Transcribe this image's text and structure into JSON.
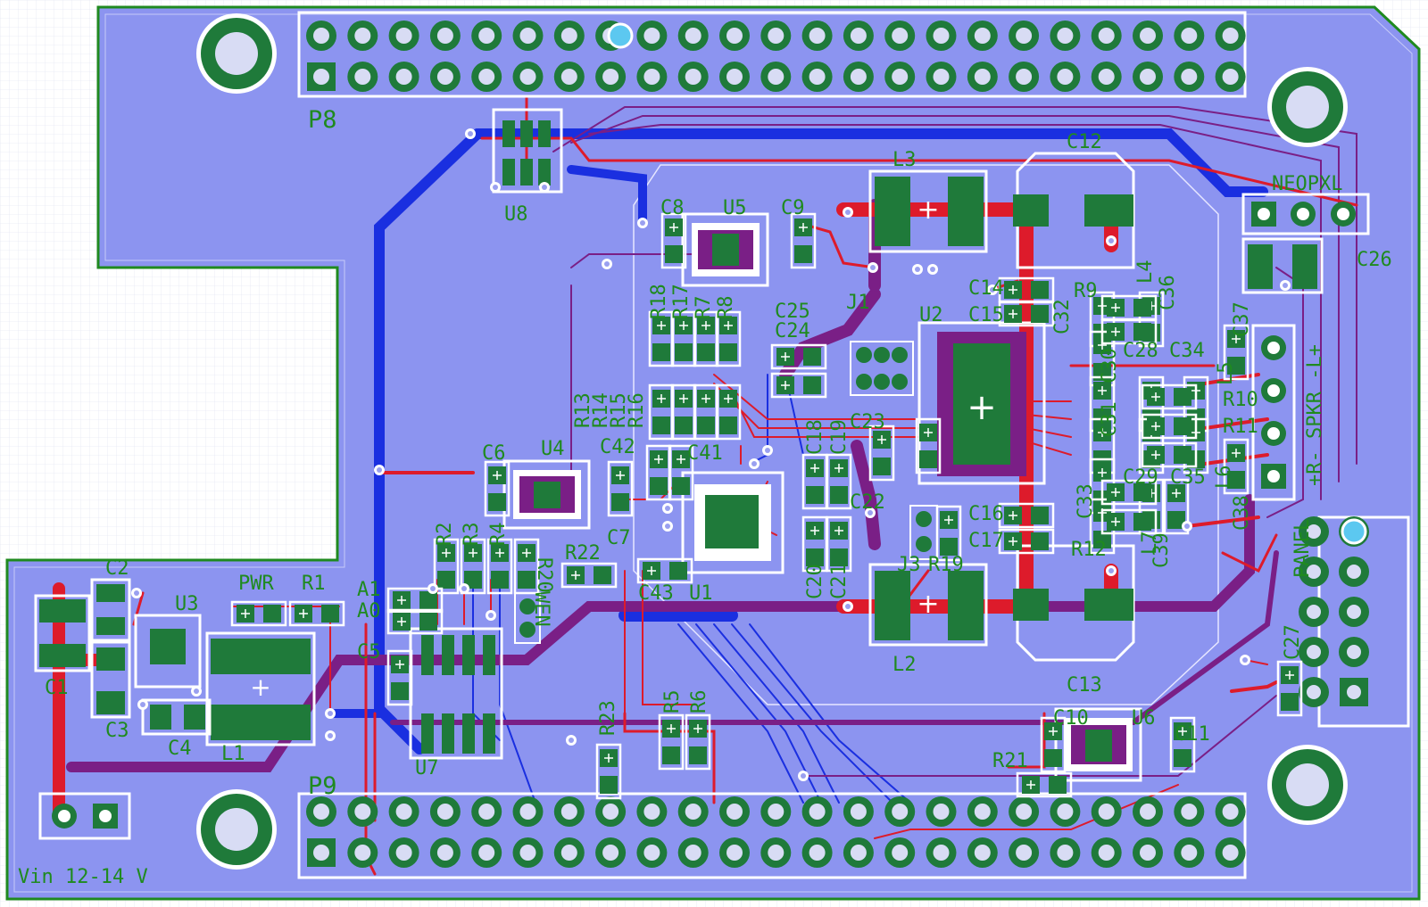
{
  "colors": {
    "background": "#ffffff",
    "grid": "#d9dcef",
    "board_fill": "#8c94f0",
    "board_outline": "#1f8a1f",
    "copper_top": "#dd1b2b",
    "copper_bottom": "#1a2fe0",
    "copper_inner": "#7a1f86",
    "pad": "#1f7a3a",
    "via_ring": "#0e7030",
    "silkscreen_outline": "#ffffff",
    "label": "#1f8a1f",
    "highlight_pin": "#5cc8f0"
  },
  "connectors": {
    "top_header": "P8",
    "bottom_header": "P9",
    "power_in": "Vin 12-14 V",
    "neopixel": "NEOPXL",
    "speaker": "+R- SPKR -L+",
    "panel": "PANEL"
  },
  "components": [
    "C1",
    "C2",
    "U3",
    "PWR",
    "R1",
    "C3",
    "C4",
    "L1",
    "A1",
    "A0",
    "C5",
    "U7",
    "R2",
    "R3",
    "R4",
    "R20",
    "R22",
    "WEN",
    "C6",
    "U4",
    "C7",
    "C42",
    "C41",
    "C43",
    "U1",
    "R23",
    "R5",
    "R6",
    "R13",
    "R14",
    "R15",
    "R16",
    "R18",
    "R17",
    "R7",
    "R8",
    "C8",
    "U5",
    "C9",
    "U8",
    "C25",
    "C24",
    "J1",
    "C18",
    "C19",
    "C23",
    "C22",
    "C20",
    "C21",
    "J3",
    "R19",
    "U2",
    "C14",
    "C15",
    "C16",
    "C17",
    "L3",
    "L2",
    "C12",
    "C13",
    "R9",
    "C36",
    "C32",
    "C28",
    "C34",
    "C37",
    "C30",
    "C31",
    "R10",
    "R11",
    "C29",
    "C35",
    "C33",
    "R12",
    "C39",
    "L4",
    "L5",
    "L6",
    "L7",
    "C38",
    "C26",
    "C27",
    "C10",
    "U6",
    "C11",
    "R21"
  ],
  "icons": [
    "pcb-layout",
    "mounting-hole-icon",
    "via-icon",
    "header-pin-icon",
    "polarity-plus-icon"
  ]
}
